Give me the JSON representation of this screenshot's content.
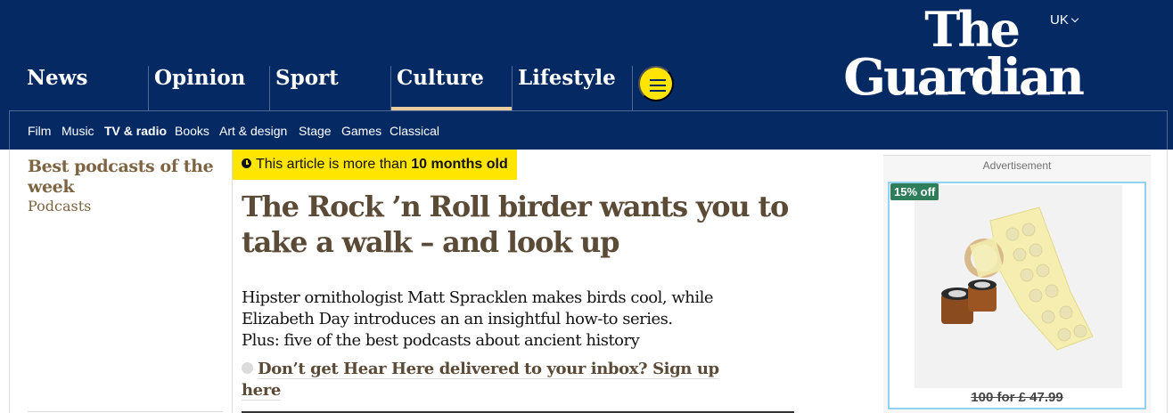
{
  "header": {
    "edition": "UK",
    "logo_line1": "The",
    "logo_line2": "Guardian",
    "brand_color": "#052962",
    "accent_color": "#ffe500",
    "pillars": [
      {
        "label": "News"
      },
      {
        "label": "Opinion"
      },
      {
        "label": "Sport"
      },
      {
        "label": "Culture",
        "active": true
      },
      {
        "label": "Lifestyle"
      }
    ],
    "menu_icon": "hamburger-icon",
    "subnav": [
      {
        "label": "Film"
      },
      {
        "label": "Music"
      },
      {
        "label": "TV & radio",
        "active": true
      },
      {
        "label": "Books"
      },
      {
        "label": "Art & design"
      },
      {
        "label": "Stage"
      },
      {
        "label": "Games"
      },
      {
        "label": "Classical"
      }
    ]
  },
  "article": {
    "series_title": "Best podcasts of the week",
    "section": "Podcasts",
    "age_warning_prefix": "This article is more than ",
    "age_warning_bold": "10 months old",
    "age_icon": "clock-icon",
    "headline": "The Rock ’n Roll birder wants you to take a walk – and look up",
    "standfirst": "Hipster ornithologist Matt Spracklen makes birds cool, while Elizabeth Day introduces an an insightful how-to series. Plus: five of the best podcasts about ancient history",
    "newsletter_cta": "Don’t get Hear Here delivered to your inbox? Sign up here"
  },
  "ad": {
    "label": "Advertisement",
    "badge": "15% off",
    "price": "100 for £ 47.99",
    "border_color": "#8fd3f0",
    "badge_color": "#2e7d5b"
  }
}
